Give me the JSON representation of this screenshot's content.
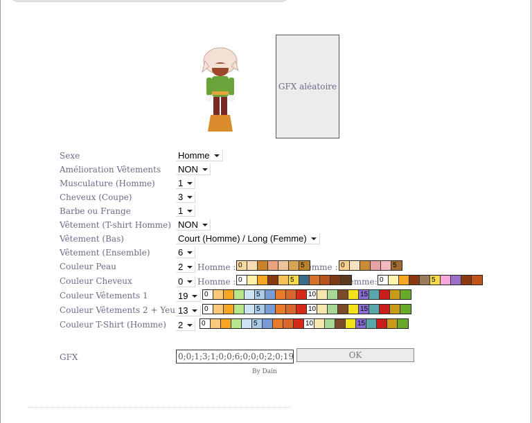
{
  "gfx_random_button": "GFX aléatoire",
  "form": {
    "rows": [
      {
        "label": "Sexe",
        "value": "Homme"
      },
      {
        "label": "Amélioration Vêtements",
        "value": "NON"
      },
      {
        "label": "Musculature (Homme)",
        "value": "1"
      },
      {
        "label": "Cheveux (Coupe)",
        "value": "3"
      },
      {
        "label": "Barbe ou Frange",
        "value": "1"
      },
      {
        "label": "Vêtement (T-shirt Homme)",
        "value": "NON"
      },
      {
        "label": "Vêtement (Bas)",
        "value": "Court (Homme) / Long (Femme)"
      },
      {
        "label": "Vêtement (Ensemble)",
        "value": "6"
      },
      {
        "label": "Couleur Peau",
        "value": "2"
      },
      {
        "label": "Couleur Cheveux",
        "value": "0"
      },
      {
        "label": "Couleur Vêtements 1",
        "value": "19"
      },
      {
        "label": "Couleur Vêtements 2 + Yeux",
        "value": "13"
      },
      {
        "label": "Couleur T-Shirt (Homme)",
        "value": "2"
      }
    ]
  },
  "palette_labels": {
    "peau_homme": "Homme :",
    "peau_femme": "Femme :",
    "cheveux_homme": "Homme :",
    "cheveux_femme": "Femme:"
  },
  "palettes": {
    "peau_homme": [
      {
        "color": "#fbd9a4",
        "text": "0"
      },
      {
        "color": "#f5deb4",
        "text": ""
      },
      {
        "color": "#c8832b",
        "text": ""
      },
      {
        "color": "#e9a47b",
        "text": ""
      },
      {
        "color": "#efc39a",
        "text": ""
      },
      {
        "color": "#d9a552",
        "text": ""
      },
      {
        "color": "#b8812e",
        "text": "5"
      }
    ],
    "peau_femme": [
      {
        "color": "#f8cf8e",
        "text": "0"
      },
      {
        "color": "#f8e1bd",
        "text": ""
      },
      {
        "color": "#c98a3a",
        "text": ""
      },
      {
        "color": "#e9a2a2",
        "text": ""
      },
      {
        "color": "#f4b8bf",
        "text": ""
      },
      {
        "color": "#a26a33",
        "text": "5"
      }
    ],
    "cheveux_homme": [
      {
        "color": "#ffffff",
        "text": "0"
      },
      {
        "color": "#fff1a6",
        "text": ""
      },
      {
        "color": "#f6a623",
        "text": ""
      },
      {
        "color": "#8a3a10",
        "text": ""
      },
      {
        "color": "#f3c15a",
        "text": ""
      },
      {
        "color": "#f7d94a",
        "text": "5"
      },
      {
        "color": "#3b6c88",
        "text": ""
      },
      {
        "color": "#d6722a",
        "text": ""
      },
      {
        "color": "#b5531f",
        "text": ""
      },
      {
        "color": "#7a3a16",
        "text": ""
      },
      {
        "color": "#5c3a22",
        "text": ""
      }
    ],
    "cheveux_femme": [
      {
        "color": "#ffffff",
        "text": "0"
      },
      {
        "color": "#fff3b0",
        "text": ""
      },
      {
        "color": "#f6a623",
        "text": ""
      },
      {
        "color": "#8a3a10",
        "text": ""
      },
      {
        "color": "#9a7b5a",
        "text": ""
      },
      {
        "color": "#f7d94a",
        "text": "5"
      },
      {
        "color": "#f4a7d8",
        "text": ""
      },
      {
        "color": "#9b6fc8",
        "text": ""
      },
      {
        "color": "#8a3a10",
        "text": ""
      },
      {
        "color": "#c0551a",
        "text": ""
      }
    ],
    "vetements": [
      {
        "color": "#ffffff",
        "text": "0"
      },
      {
        "color": "#f9c97c",
        "text": ""
      },
      {
        "color": "#f6a623",
        "text": ""
      },
      {
        "color": "#b8e68c",
        "text": ""
      },
      {
        "color": "#cfe4f2",
        "text": ""
      },
      {
        "color": "#aacbe8",
        "text": "5"
      },
      {
        "color": "#7a9bd6",
        "text": ""
      },
      {
        "color": "#e87b2a",
        "text": ""
      },
      {
        "color": "#d9672a",
        "text": ""
      },
      {
        "color": "#d42a1a",
        "text": ""
      },
      {
        "color": "#ffffff",
        "text": "10"
      },
      {
        "color": "#f6e7b0",
        "text": ""
      },
      {
        "color": "#a8d898",
        "text": ""
      },
      {
        "color": "#7a4a2a",
        "text": ""
      },
      {
        "color": "#f3e21a",
        "text": ""
      },
      {
        "color": "#8a6fd0",
        "text": "15"
      },
      {
        "color": "#5aa6a8",
        "text": ""
      },
      {
        "color": "#c81e1e",
        "text": ""
      },
      {
        "color": "#c89a1a",
        "text": ""
      },
      {
        "color": "#6aaa2a",
        "text": ""
      }
    ]
  },
  "gfx": {
    "label": "GFX",
    "value": "0;0;1;3;1;0;0;6;0;0;0;2;0;19;1",
    "ok_label": "OK"
  },
  "credit": "By Dain"
}
